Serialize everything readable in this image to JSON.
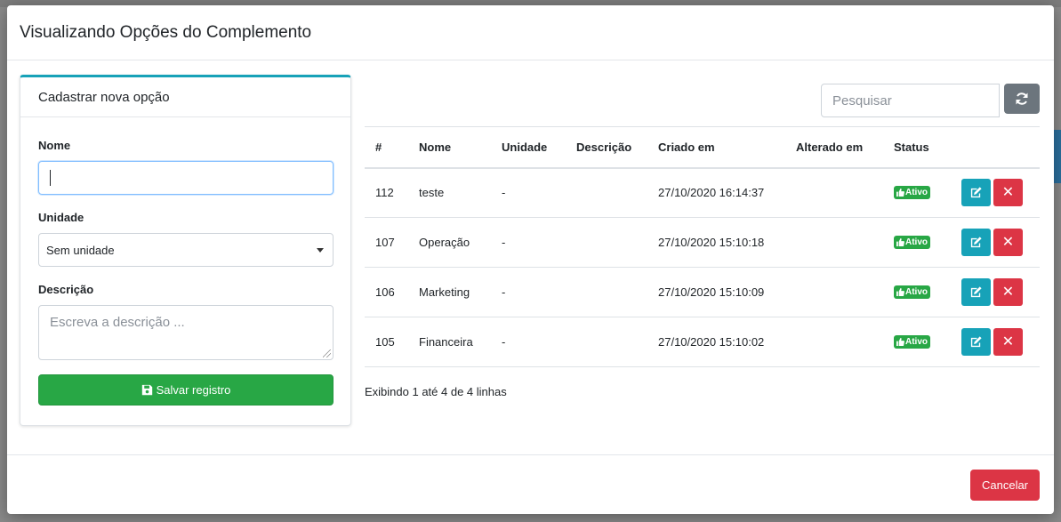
{
  "modal": {
    "title": "Visualizando Opções do Complemento"
  },
  "form": {
    "header": "Cadastrar nova opção",
    "nome_label": "Nome",
    "nome_value": "",
    "unidade_label": "Unidade",
    "unidade_selected": "Sem unidade",
    "descricao_label": "Descrição",
    "descricao_placeholder": "Escreva a descrição ...",
    "save_label": "Salvar registro"
  },
  "search": {
    "placeholder": "Pesquisar"
  },
  "table": {
    "columns": [
      "#",
      "Nome",
      "Unidade",
      "Descrição",
      "Criado em",
      "Alterado em",
      "Status"
    ],
    "rows": [
      {
        "id": "112",
        "nome": "teste",
        "unidade": "-",
        "descricao": "",
        "criado_em": "27/10/2020 16:14:37",
        "alterado_em": "",
        "status": "Ativo"
      },
      {
        "id": "107",
        "nome": "Operação",
        "unidade": "-",
        "descricao": "",
        "criado_em": "27/10/2020 15:10:18",
        "alterado_em": "",
        "status": "Ativo"
      },
      {
        "id": "106",
        "nome": "Marketing",
        "unidade": "-",
        "descricao": "",
        "criado_em": "27/10/2020 15:10:09",
        "alterado_em": "",
        "status": "Ativo"
      },
      {
        "id": "105",
        "nome": "Financeira",
        "unidade": "-",
        "descricao": "",
        "criado_em": "27/10/2020 15:10:02",
        "alterado_em": "",
        "status": "Ativo"
      }
    ],
    "info": "Exibindo 1 até 4 de 4 linhas"
  },
  "footer": {
    "cancel_label": "Cancelar"
  },
  "colors": {
    "primary_teal": "#17a2b8",
    "success_green": "#28a745",
    "danger_red": "#dc3545",
    "secondary_gray": "#6c757d"
  }
}
